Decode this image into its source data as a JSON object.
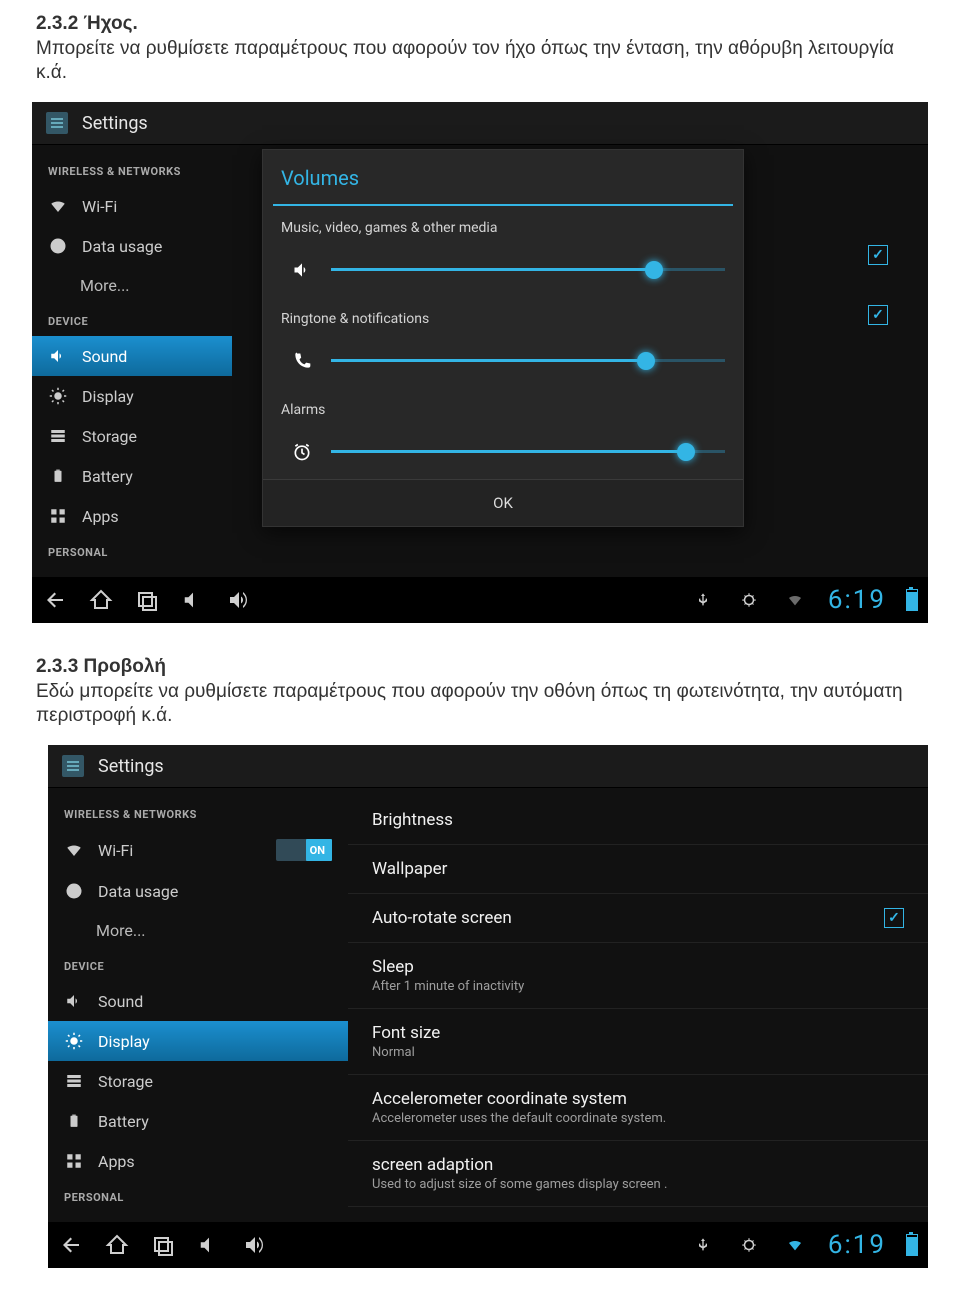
{
  "doc": {
    "section1_num": "2.3.2 ",
    "section1_title": "Ήχος.",
    "section1_body": "Μπορείτε να ρυθμίσετε παραμέτρους που αφορούν τον ήχο όπως την ένταση, την αθόρυβη λειτουργία κ.ά.",
    "section2_num": "2.3.3 ",
    "section2_title": "Προβολή",
    "section2_body": "Εδώ μπορείτε να ρυθμίσετε παραμέτρους που αφορούν την οθόνη όπως τη φωτεινότητα, την αυτόματη περιστροφή κ.ά."
  },
  "shared": {
    "settings": "Settings",
    "wireless_header": "WIRELESS & NETWORKS",
    "device_header": "DEVICE",
    "personal_header": "PERSONAL",
    "wifi": "Wi-Fi",
    "data_usage": "Data usage",
    "more": "More...",
    "sound": "Sound",
    "display": "Display",
    "storage": "Storage",
    "battery": "Battery",
    "apps": "Apps",
    "on": "ON",
    "clock": "6:19"
  },
  "volumes": {
    "title": "Volumes",
    "media_label": "Music, video, games & other media",
    "ringtone_label": "Ringtone & notifications",
    "alarms_label": "Alarms",
    "ok": "OK",
    "media_pct": 82,
    "ringtone_pct": 80,
    "alarms_pct": 90
  },
  "display_settings": {
    "brightness": "Brightness",
    "wallpaper": "Wallpaper",
    "autorotate": "Auto-rotate screen",
    "sleep": "Sleep",
    "sleep_sub": "After 1 minute of inactivity",
    "font": "Font size",
    "font_sub": "Normal",
    "accel": "Accelerometer coordinate system",
    "accel_sub": "Accelerometer uses the default coordinate system.",
    "adapt": "screen adaption",
    "adapt_sub": "Used to adjust size of some games display screen ."
  }
}
